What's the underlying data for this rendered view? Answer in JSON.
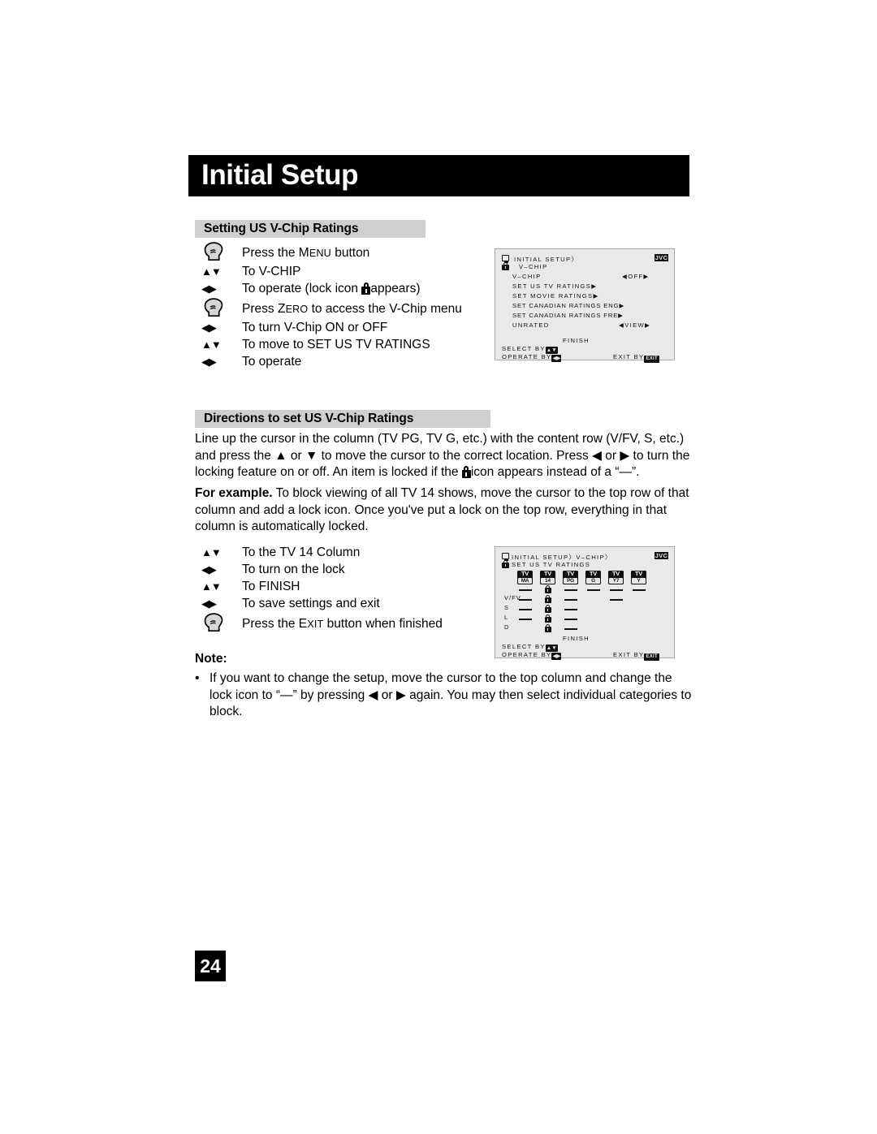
{
  "page": {
    "chapter_title": "Initial Setup",
    "page_number": "24"
  },
  "section_setting": {
    "heading": "Setting US V-Chip Ratings",
    "steps": [
      {
        "key": "hand",
        "key_glyph": "",
        "text_pre": "Press the ",
        "text_sc": "Menu",
        "text_post": " button"
      },
      {
        "key": "updown",
        "key_glyph": "▲▼",
        "text_pre": "To V-CHIP",
        "text_sc": "",
        "text_post": ""
      },
      {
        "key": "leftright",
        "key_glyph": "◀▶",
        "text_pre": "To operate (lock icon ",
        "text_sc": "",
        "text_post": "appears)"
      },
      {
        "key": "hand",
        "key_glyph": "",
        "text_pre": "Press ",
        "text_sc": "Zero",
        "text_post": " to access the V-Chip menu"
      },
      {
        "key": "leftright",
        "key_glyph": "◀▶",
        "text_pre": "To turn V-Chip ON or OFF",
        "text_sc": "",
        "text_post": ""
      },
      {
        "key": "updown",
        "key_glyph": "▲▼",
        "text_pre": "To move to SET US TV RATINGS",
        "text_sc": "",
        "text_post": ""
      },
      {
        "key": "leftright",
        "key_glyph": "◀▶",
        "text_pre": "To operate",
        "text_sc": "",
        "text_post": ""
      }
    ]
  },
  "section_directions": {
    "heading": "Directions to set US V-Chip Ratings",
    "paragraph_a": "Line up the cursor in the column (TV PG, TV G, etc.) with the content row (V/FV, S, etc.) and press the ▲ or ▼ to move the cursor to the correct location. Press ◀ or ▶ to turn the locking feature on or off. An item is locked if the ",
    "paragraph_a_tail": "icon appears instead of a “—”.",
    "example_label": "For example.",
    "example_text": " To block viewing of all TV 14 shows, move the cursor to the top row of that column and add a lock icon. Once you've put a lock on the top row, everything in that column is automatically locked.",
    "steps": [
      {
        "key": "updown",
        "key_glyph": "▲▼",
        "text_pre": "To the TV 14 Column",
        "text_sc": "",
        "text_post": ""
      },
      {
        "key": "leftright",
        "key_glyph": "◀▶",
        "text_pre": "To turn on the lock",
        "text_sc": "",
        "text_post": ""
      },
      {
        "key": "updown",
        "key_glyph": "▲▼",
        "text_pre": "To FINISH",
        "text_sc": "",
        "text_post": ""
      },
      {
        "key": "leftright",
        "key_glyph": "◀▶",
        "text_pre": "To save settings and exit",
        "text_sc": "",
        "text_post": ""
      },
      {
        "key": "hand",
        "key_glyph": "",
        "text_pre": "Press the ",
        "text_sc": "Exit",
        "text_post": " button when finished"
      }
    ]
  },
  "note": {
    "label": "Note:",
    "bullet_char": "•",
    "text": "If you want to change the setup, move the cursor to the top column and change the lock icon to “—” by pressing ◀ or ▶ again. You may then select individual categories to block."
  },
  "osd1": {
    "brand": "JVC",
    "breadcrumb_line1": "INITIAL SETUP〉",
    "breadcrumb_line2": "V–CHIP",
    "rows": [
      {
        "label": "V–CHIP",
        "value": "◀OFF▶"
      },
      {
        "label": "SET US TV RATINGS▶",
        "value": ""
      },
      {
        "label": "SET MOVIE RATINGS▶",
        "value": ""
      },
      {
        "label": "SET CANADIAN RATINGS ENG▶",
        "value": ""
      },
      {
        "label": "SET CANADIAN RATINGS FRE▶",
        "value": ""
      },
      {
        "label": "UNRATED",
        "value": "◀VIEW▶"
      }
    ],
    "finish": "FINISH",
    "select_by": "SELECT    BY",
    "operate_by": "OPERATE BY",
    "exit_by": "EXIT BY",
    "exit_key": "EXIT"
  },
  "osd2": {
    "brand": "JVC",
    "breadcrumb_line1": "INITIAL SETUP〉V–CHIP〉",
    "breadcrumb_line2": "SET US TV RATINGS",
    "columns": [
      {
        "top": "TV",
        "bottom": "MA"
      },
      {
        "top": "TV",
        "bottom": "14"
      },
      {
        "top": "TV",
        "bottom": "PG"
      },
      {
        "top": "TV",
        "bottom": "G"
      },
      {
        "top": "TV",
        "bottom": "Y7"
      },
      {
        "top": "TV",
        "bottom": "Y"
      }
    ],
    "row_labels": [
      "",
      "V/FV",
      "S",
      "L",
      "D"
    ],
    "cells": [
      [
        "dash",
        "lock",
        "dash",
        "dash",
        "dash",
        "dash"
      ],
      [
        "dash",
        "lock",
        "dash",
        "",
        "dash",
        ""
      ],
      [
        "dash",
        "lock",
        "dash",
        "",
        "",
        ""
      ],
      [
        "dash",
        "lock",
        "dash",
        "",
        "",
        ""
      ],
      [
        "",
        "lock",
        "dash",
        "",
        "",
        ""
      ]
    ],
    "finish": "FINISH",
    "select_by": "SELECT    BY",
    "operate_by": "OPERATE BY",
    "exit_by": "EXIT BY",
    "exit_key": "EXIT"
  },
  "colors": {
    "banner_bg": "#000000",
    "section_head_bg": "#cfcfcf",
    "osd_bg": "#e9e9e9",
    "osd_border": "#a8a8a8"
  }
}
